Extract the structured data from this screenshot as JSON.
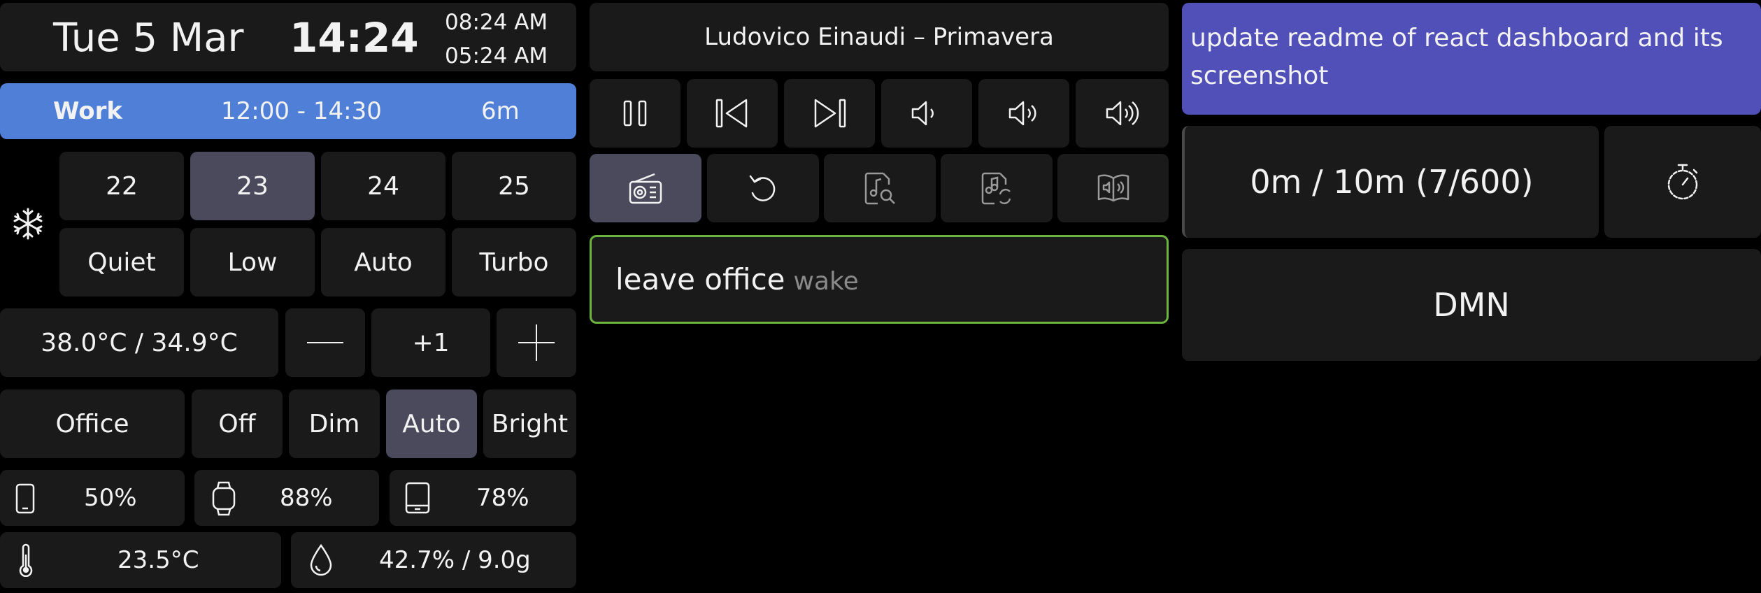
{
  "clock": {
    "date": "Tue 5 Mar",
    "time": "14:24",
    "alt_time_1": "08:24 AM",
    "alt_time_2": "05:24 AM"
  },
  "event": {
    "name": "Work",
    "range": "12:00 - 14:30",
    "remaining": "6m",
    "color": "#4f7fd6"
  },
  "ac": {
    "icon": "snowflake-icon",
    "temps": [
      "22",
      "23",
      "24",
      "25"
    ],
    "selected_temp": "23",
    "fan_modes": [
      "Quiet",
      "Low",
      "Auto",
      "Turbo"
    ]
  },
  "heating": {
    "reading": "38.0°C / 34.9°C",
    "offset": "+1",
    "minus_icon": "minus-icon",
    "plus_icon": "plus-icon"
  },
  "lights": {
    "room": "Office",
    "modes": [
      "Off",
      "Dim",
      "Auto",
      "Bright"
    ],
    "selected": "Auto"
  },
  "batteries": {
    "phone": "50%",
    "watch": "88%",
    "tablet": "78%"
  },
  "environment": {
    "temperature": "23.5°C",
    "humidity": "42.7% / 9.0g"
  },
  "media": {
    "now_playing": "Ludovico Einaudi – Primavera",
    "controls": [
      "pause-icon",
      "previous-track-icon",
      "next-track-icon",
      "volume-low-icon",
      "volume-medium-icon",
      "volume-high-icon"
    ],
    "sources": [
      "radio-icon",
      "replay-icon",
      "music-search-icon",
      "music-repeat-icon",
      "audiobook-icon"
    ],
    "selected_source": "radio-icon"
  },
  "reminder": {
    "title": "leave office",
    "tag": "wake",
    "border_color": "#6cb33f"
  },
  "task": {
    "text": "update readme of react dashboard and its screenshot",
    "color": "#5050b8"
  },
  "timer": {
    "label": "0m / 10m (7/600)",
    "icon": "stopwatch-icon"
  },
  "mode": {
    "label": "DMN"
  }
}
